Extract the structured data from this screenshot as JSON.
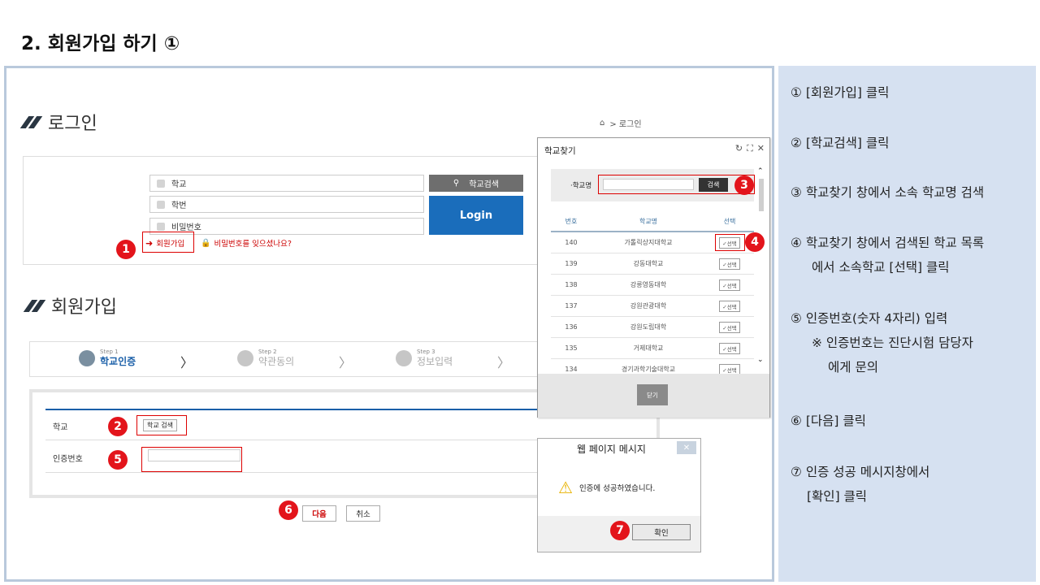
{
  "slide": {
    "title": "2. 회원가입 하기 ①"
  },
  "steps": [
    {
      "lines": [
        "① [회원가입] 클릭"
      ]
    },
    {
      "lines": [
        "② [학교검색] 클릭"
      ]
    },
    {
      "lines": [
        "③ 학교찾기 창에서 소속 학교명 검색"
      ]
    },
    {
      "lines": [
        "④ 학교찾기 창에서 검색된 학교 목록",
        "에서 소속학교 [선택] 클릭"
      ]
    },
    {
      "lines": [
        "⑤ 인증번호(숫자 4자리) 입력",
        "※ 인증번호는 진단시험 담당자",
        "에게 문의"
      ]
    },
    {
      "lines": [
        "⑥ [다음] 클릭"
      ]
    },
    {
      "lines": [
        "⑦ 인증 성공 메시지창에서",
        "[확인] 클릭"
      ]
    }
  ],
  "login": {
    "heading": "로그인",
    "breadcrumb": ">  로그인",
    "school_placeholder": "학교",
    "id_placeholder": "학번",
    "pw_placeholder": "비밀번호",
    "school_search_btn": "학교검색",
    "login_btn": "Login",
    "signup_link": "회원가입",
    "forgot_link": "비밀번호를 잊으셨나요?"
  },
  "signup": {
    "heading": "회원가입",
    "steps": [
      {
        "small": "Step 1",
        "label": "학교인증"
      },
      {
        "small": "Step 2",
        "label": "약관동의"
      },
      {
        "small": "Step 3",
        "label": "정보입력"
      }
    ],
    "school_label": "학교",
    "school_btn": "학교 검색",
    "auth_label": "인증번호",
    "next_btn": "다음",
    "cancel_btn": "취소"
  },
  "popup": {
    "title": "학교찾기",
    "search_label": "·학교명",
    "search_btn": "검색",
    "col_no": "번호",
    "col_name": "학교명",
    "col_sel": "선택",
    "select_label": "✓선택",
    "rows": [
      {
        "no": "140",
        "name": "가톨릭상지대학교"
      },
      {
        "no": "139",
        "name": "강동대학교"
      },
      {
        "no": "138",
        "name": "강릉영동대학"
      },
      {
        "no": "137",
        "name": "강원관광대학"
      },
      {
        "no": "136",
        "name": "강원도립대학"
      },
      {
        "no": "135",
        "name": "거제대학교"
      },
      {
        "no": "134",
        "name": "경기과학기술대학교"
      }
    ],
    "close_btn": "닫기"
  },
  "message": {
    "title": "웹 페이지 메시지",
    "text": "인증에 성공하였습니다.",
    "ok_btn": "확인"
  },
  "markers": [
    "1",
    "2",
    "3",
    "4",
    "5",
    "6",
    "7"
  ],
  "colors": {
    "marker_red": "#e3141b",
    "login_blue": "#1a6dbb",
    "side_panel": "#d6e1f1"
  }
}
